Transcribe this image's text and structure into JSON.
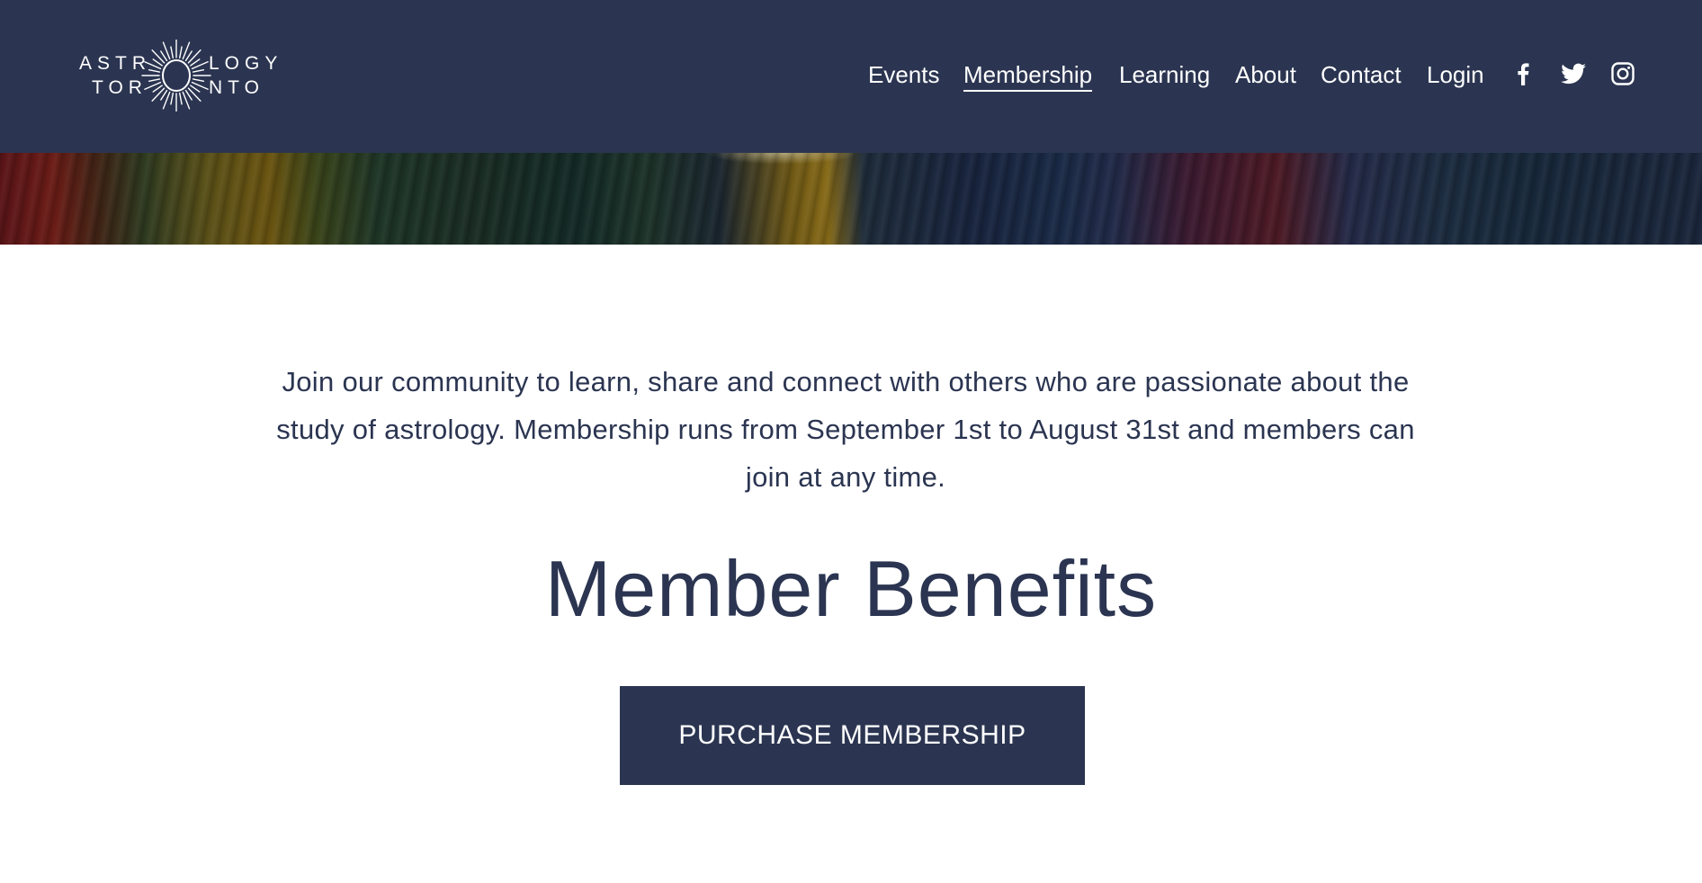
{
  "header": {
    "logo": {
      "line1_left": "ASTR",
      "line1_right": "LOGY",
      "line2_left": "TOR",
      "line2_right": "NTO",
      "icon": "sun-logo-icon"
    },
    "nav": [
      {
        "label": "Events",
        "active": false
      },
      {
        "label": "Membership",
        "active": true
      },
      {
        "label": "Learning",
        "active": false
      },
      {
        "label": "About",
        "active": false
      },
      {
        "label": "Contact",
        "active": false
      },
      {
        "label": "Login",
        "active": false
      }
    ],
    "social": [
      {
        "icon": "facebook-icon"
      },
      {
        "icon": "twitter-icon"
      },
      {
        "icon": "instagram-icon"
      }
    ]
  },
  "main": {
    "intro": "Join our community to learn, share and connect with others who are passionate about the study of astrology. Membership runs from September 1st to August 31st and members can join at any time.",
    "heading": "Member Benefits",
    "cta_label": "PURCHASE MEMBERSHIP"
  },
  "colors": {
    "brand_navy": "#2b3551",
    "text_on_dark": "#ffffff",
    "background": "#ffffff"
  }
}
